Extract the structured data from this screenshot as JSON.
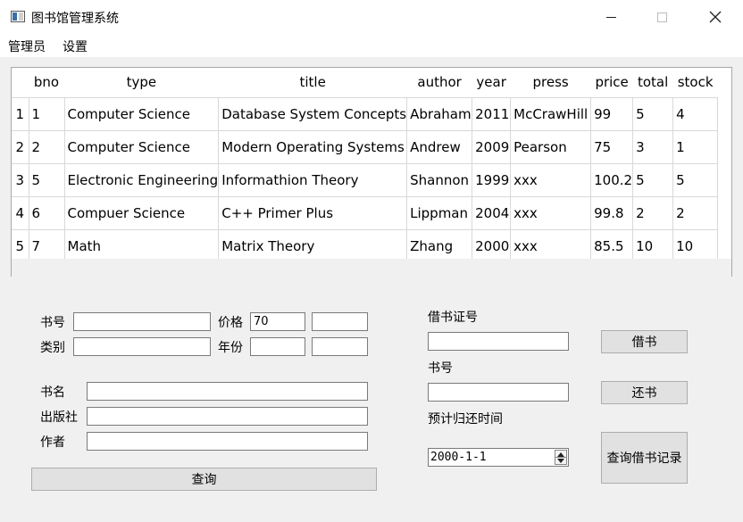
{
  "window": {
    "title": "图书馆管理系统"
  },
  "menu": {
    "items": [
      "管理员",
      "设置"
    ]
  },
  "table": {
    "columns": [
      "bno",
      "type",
      "title",
      "author",
      "year",
      "press",
      "price",
      "total",
      "stock"
    ],
    "rows": [
      [
        "1",
        "Computer Science",
        "Database System Concepts",
        "Abraham",
        "2011",
        "McCrawHill",
        "99",
        "5",
        "4"
      ],
      [
        "2",
        "Computer Science",
        "Modern Operating Systems",
        "Andrew",
        "2009",
        "Pearson",
        "75",
        "3",
        "1"
      ],
      [
        "5",
        "Electronic Engineering",
        "Informathion Theory",
        "Shannon",
        "1999",
        "xxx",
        "100.2",
        "5",
        "5"
      ],
      [
        "6",
        "Compuer Science",
        "C++ Primer Plus",
        "Lippman",
        "2004",
        "xxx",
        "99.8",
        "2",
        "2"
      ],
      [
        "7",
        "Math",
        "Matrix Theory",
        "Zhang",
        "2000",
        "xxx",
        "85.5",
        "10",
        "10"
      ]
    ],
    "row_numbers": [
      "1",
      "2",
      "3",
      "4",
      "5"
    ]
  },
  "query": {
    "bno_label": "书号",
    "price_label": "价格",
    "price_min_value": "70",
    "price_max_value": "",
    "type_label": "类别",
    "year_label": "年份",
    "title_label": "书名",
    "press_label": "出版社",
    "author_label": "作者",
    "query_button": "查询"
  },
  "borrow": {
    "card_label": "借书证号",
    "bno_label": "书号",
    "return_time_label": "预计归还时间",
    "date_value": "2000-1-1",
    "borrow_button": "借书",
    "return_button": "还书",
    "records_button": "查询借书记录"
  }
}
